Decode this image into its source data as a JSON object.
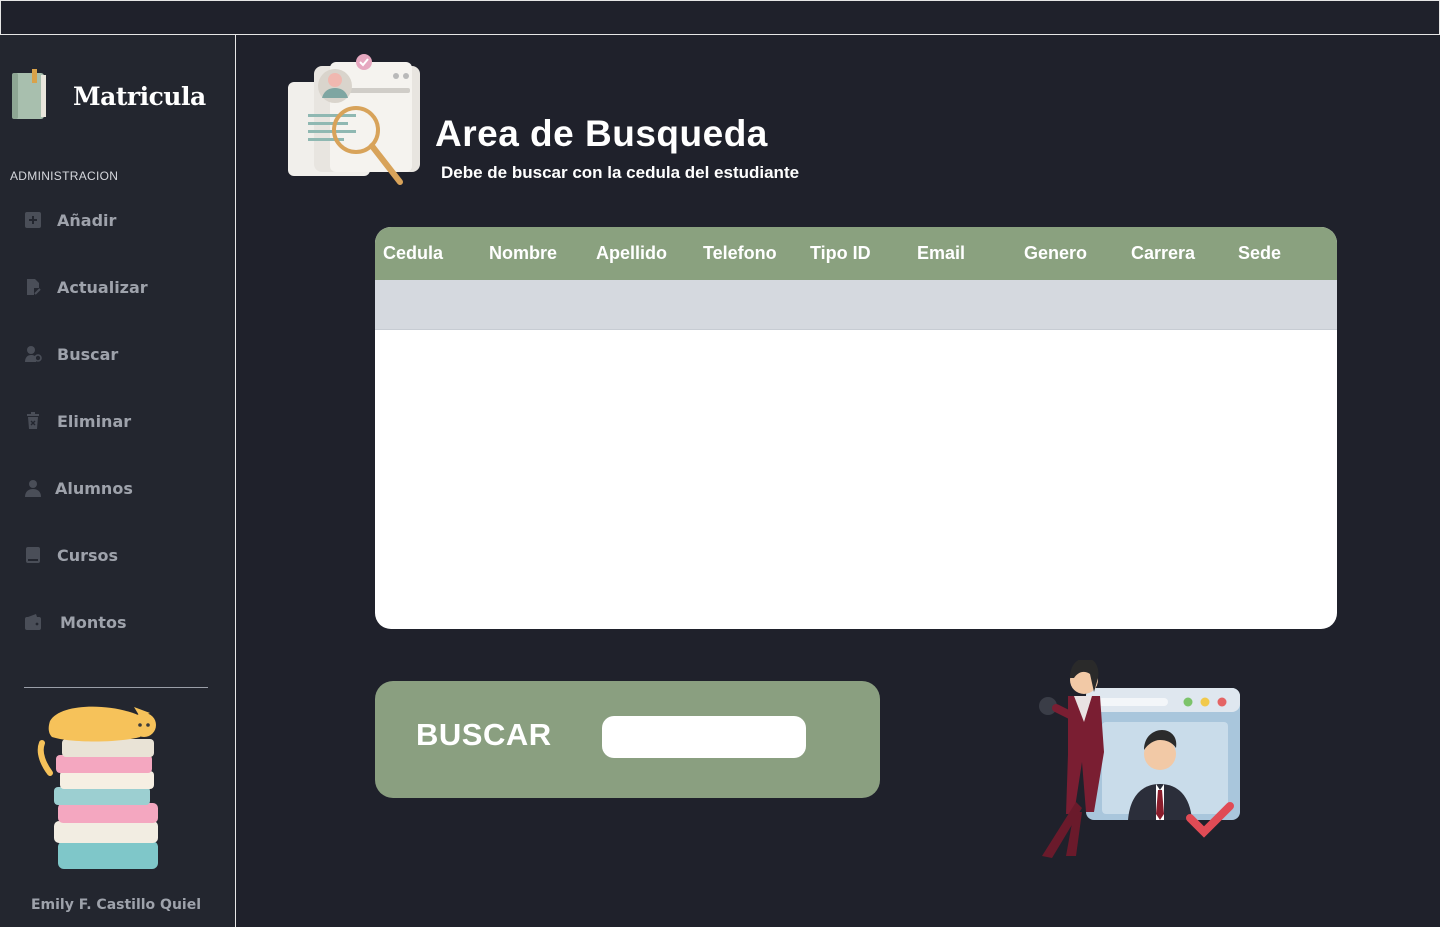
{
  "app": {
    "title": "Matricula",
    "section_label": "ADMINISTRACION",
    "author": "Emily F. Castillo Quiel"
  },
  "sidebar": {
    "items": [
      {
        "label": "Añadir",
        "icon": "plus-square-icon"
      },
      {
        "label": "Actualizar",
        "icon": "file-edit-icon"
      },
      {
        "label": "Buscar",
        "icon": "user-search-icon"
      },
      {
        "label": "Eliminar",
        "icon": "trash-icon"
      },
      {
        "label": "Alumnos",
        "icon": "person-icon"
      },
      {
        "label": "Cursos",
        "icon": "book-icon"
      },
      {
        "label": "Montos",
        "icon": "wallet-icon"
      }
    ]
  },
  "main": {
    "title": "Area de Busqueda",
    "subtitle": "Debe de buscar con la cedula del estudiante"
  },
  "table": {
    "columns": [
      "Cedula",
      "Nombre",
      "Apellido",
      "Telefono",
      "Tipo ID",
      "Email",
      "Genero",
      "Carrera",
      "Sede"
    ],
    "rows": []
  },
  "search": {
    "label": "BUSCAR",
    "value": "",
    "placeholder": ""
  },
  "colors": {
    "background": "#1f212b",
    "sidebar": "#23262f",
    "accent_green": "#8aa17f",
    "row_gray": "#d5d9df"
  }
}
